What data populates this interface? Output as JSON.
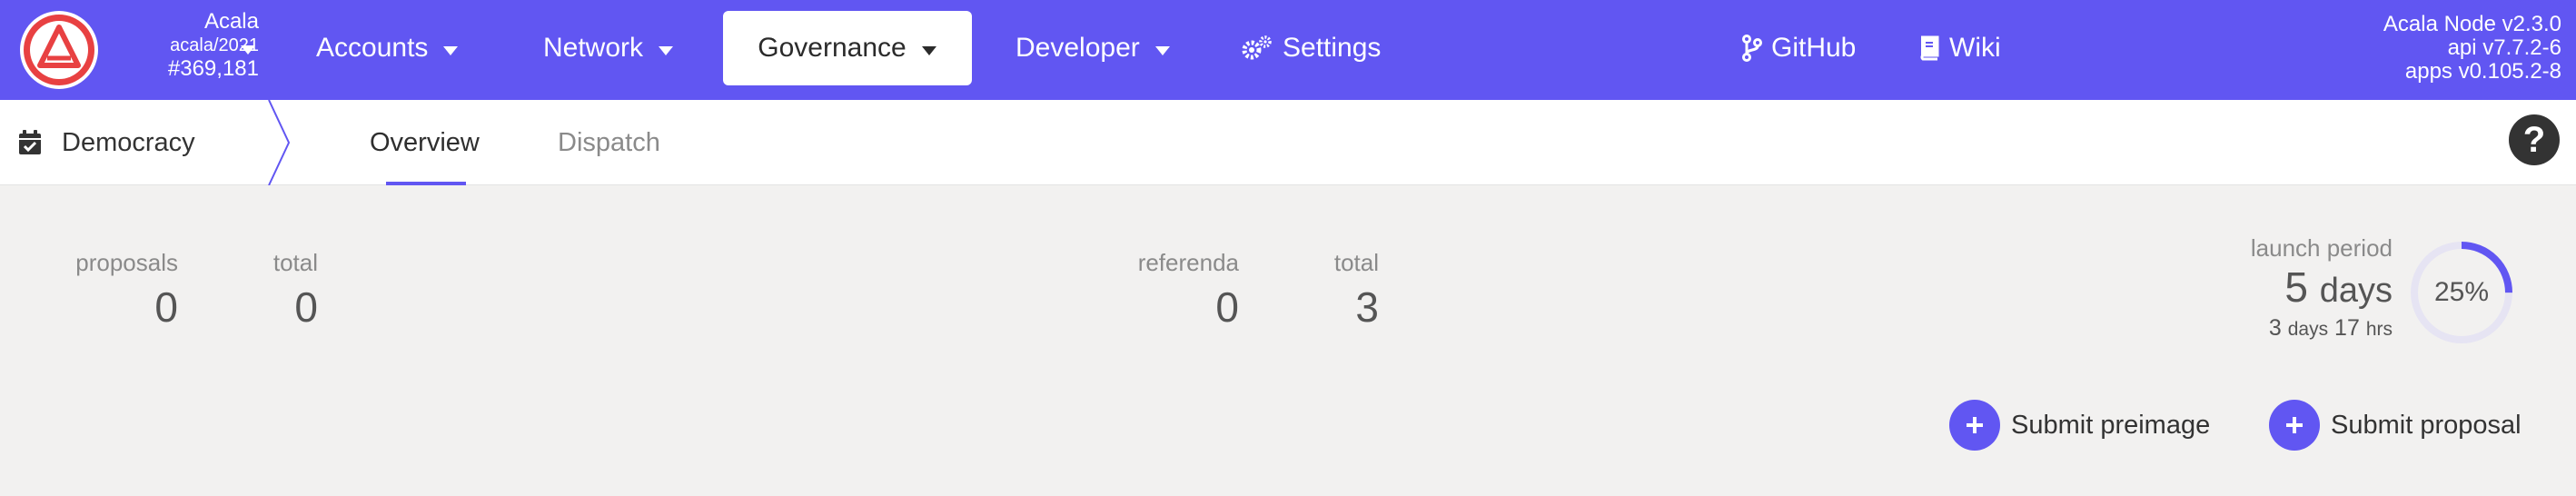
{
  "topbar": {
    "chain": {
      "name": "Acala",
      "spec": "acala/2021",
      "block": "#369,181"
    },
    "nav": [
      {
        "label": "Accounts"
      },
      {
        "label": "Network"
      },
      {
        "label": "Governance"
      },
      {
        "label": "Developer"
      },
      {
        "label": "Settings"
      }
    ],
    "links": {
      "github": "GitHub",
      "wiki": "Wiki"
    },
    "version": {
      "node": "Acala Node v2.3.0",
      "api": "api v7.7.2-6",
      "apps": "apps v0.105.2-8"
    }
  },
  "subbar": {
    "section": "Democracy",
    "tabs": [
      {
        "label": "Overview"
      },
      {
        "label": "Dispatch"
      }
    ]
  },
  "summary": {
    "proposals": {
      "label": "proposals",
      "value": "0"
    },
    "proposals_total": {
      "label": "total",
      "value": "0"
    },
    "referenda": {
      "label": "referenda",
      "value": "0"
    },
    "referenda_total": {
      "label": "total",
      "value": "3"
    },
    "launch": {
      "label": "launch period",
      "period_value": "5",
      "period_unit": "days",
      "remaining_days": "3",
      "remaining_days_unit": "days",
      "remaining_hrs": "17",
      "remaining_hrs_unit": "hrs",
      "percent_label": "25%",
      "progress": 0.25
    }
  },
  "actions": {
    "preimage": "Submit preimage",
    "proposal": "Submit proposal"
  },
  "colors": {
    "accent": "#6156f2",
    "background": "#f2f1f0"
  }
}
